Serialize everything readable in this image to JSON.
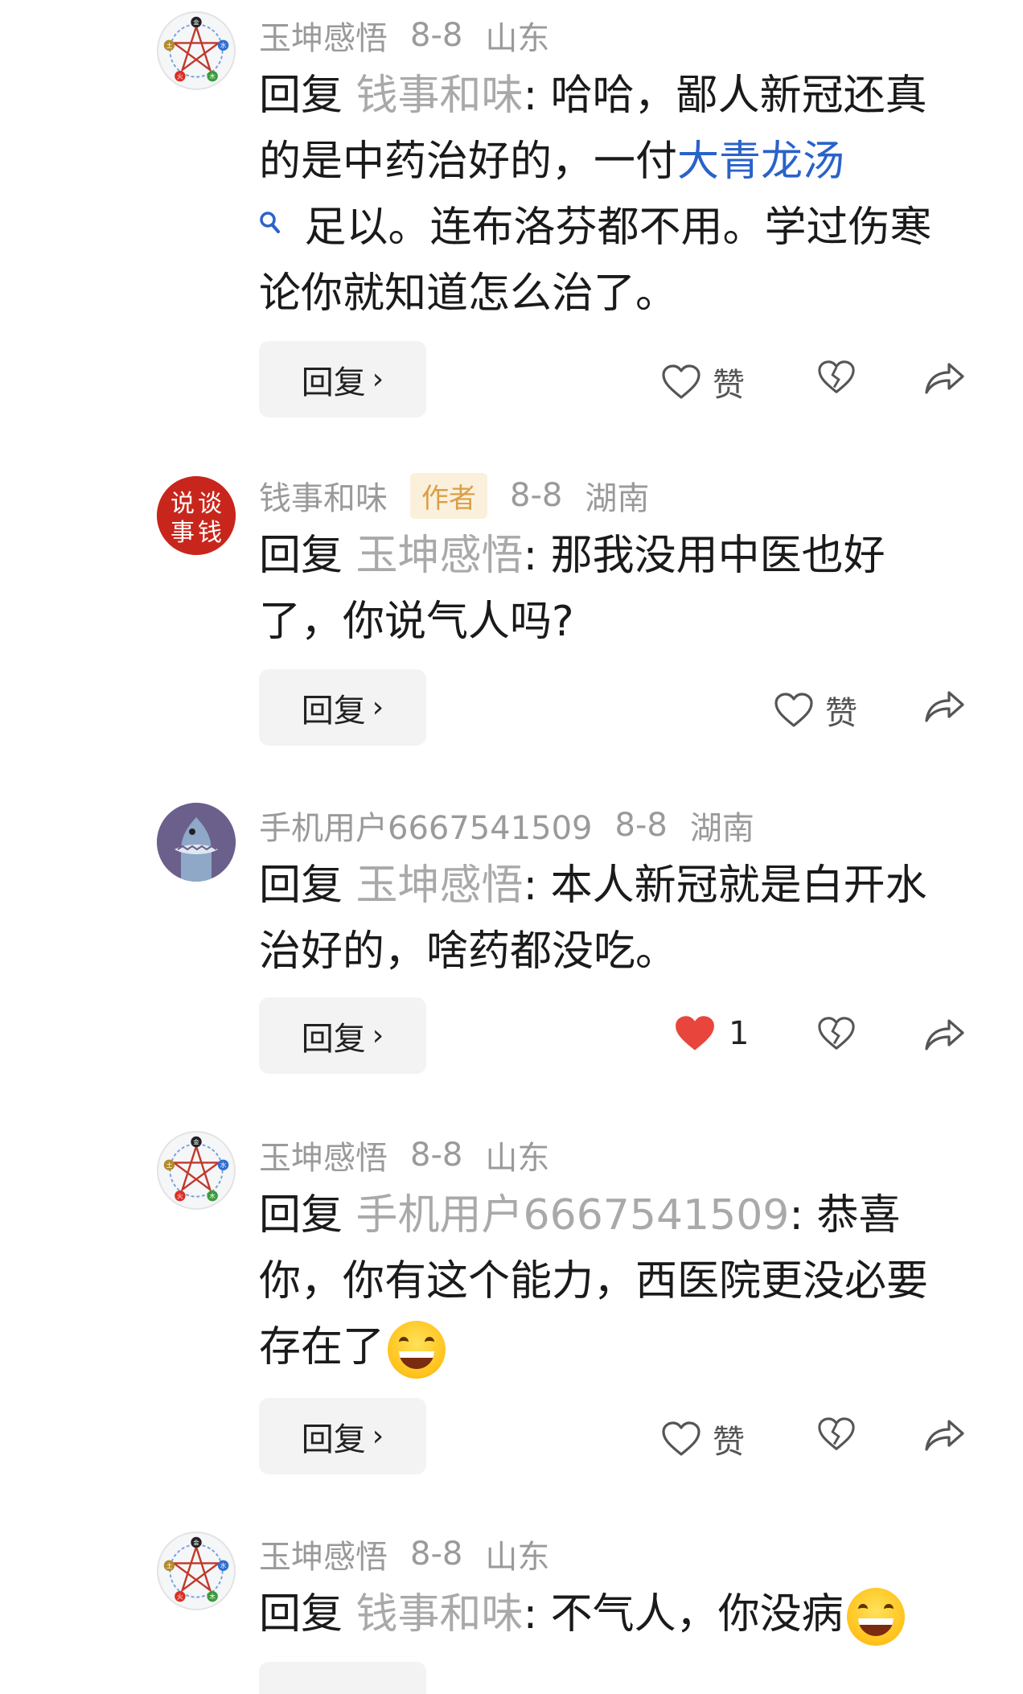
{
  "comments": [
    {
      "username": "玉坤感悟",
      "date": "8-8",
      "location": "山东",
      "reply_prefix": "回复",
      "reply_to": "钱事和味",
      "text_before": ": 哈哈，鄙人新冠还真的是中药治好的，一付",
      "link_text": "大青龙汤",
      "text_after": " 足以。连布洛芬都不用。学过伤寒论你就知道怎么治了。",
      "reply_button": "回复",
      "like_label": "赞"
    },
    {
      "username": "钱事和味",
      "author_badge": "作者",
      "date": "8-8",
      "location": "湖南",
      "reply_prefix": "回复",
      "reply_to": "玉坤感悟",
      "text": ": 那我没用中医也好了，你说气人吗?",
      "reply_button": "回复",
      "like_label": "赞"
    },
    {
      "username": "手机用户6667541509",
      "date": "8-8",
      "location": "湖南",
      "reply_prefix": "回复",
      "reply_to": "玉坤感悟",
      "text": ": 本人新冠就是白开水治好的，啥药都没吃。",
      "reply_button": "回复",
      "like_count": "1"
    },
    {
      "username": "玉坤感悟",
      "date": "8-8",
      "location": "山东",
      "reply_prefix": "回复",
      "reply_to": "手机用户6667541509",
      "text": ": 恭喜你，你有这个能力，西医院更没必要存在了",
      "reply_button": "回复",
      "like_label": "赞"
    },
    {
      "username": "玉坤感悟",
      "date": "8-8",
      "location": "山东",
      "reply_prefix": "回复",
      "reply_to": "钱事和味",
      "text": ": 不气人，你没病"
    }
  ],
  "avatars": {
    "wuxing_labels": [
      "金",
      "水",
      "木",
      "火",
      "土"
    ],
    "seal_text": "说谈事钱"
  },
  "icons": {
    "search": "search-icon",
    "heart": "heart-outline-icon",
    "heart_filled": "heart-filled-icon",
    "dislike": "broken-heart-icon",
    "share": "share-icon"
  },
  "colors": {
    "link": "#2a62c9",
    "like_active": "#e8453c",
    "badge_bg": "#fbf0dc",
    "badge_text": "#d9a047"
  }
}
